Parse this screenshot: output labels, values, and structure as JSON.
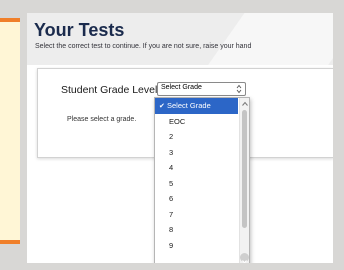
{
  "page": {
    "title": "Your Tests",
    "subtitle": "Select the correct test to continue. If you are not sure, raise your hand"
  },
  "grade": {
    "label": "Student Grade Level:",
    "selected": "Select Grade",
    "message": "Please select a grade."
  },
  "dropdown": {
    "options": [
      "Select Grade",
      "EOC",
      "2",
      "3",
      "4",
      "5",
      "6",
      "7",
      "8",
      "9"
    ],
    "selected_index": 0,
    "selected_color": "#2c66c7"
  },
  "colors": {
    "title": "#1b2b4d",
    "accent_orange": "#f07f2a",
    "card_background": "#fff6d6"
  },
  "icons": {
    "check": "checkmark-icon",
    "select": "select-arrows-icon",
    "scroll_up": "chevron-up-icon",
    "scroll_down": "chevron-down-icon"
  }
}
